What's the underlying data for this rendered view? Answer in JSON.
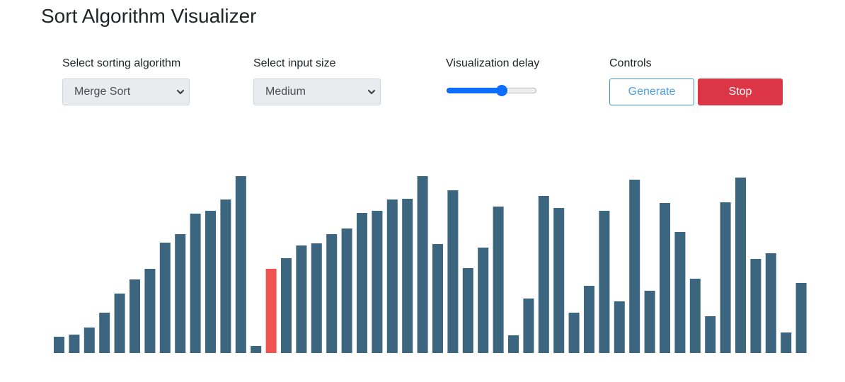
{
  "title": "Sort Algorithm Visualizer",
  "controls": {
    "algorithm": {
      "label": "Select sorting algorithm",
      "selected": "Merge Sort"
    },
    "input_size": {
      "label": "Select input size",
      "selected": "Medium"
    },
    "delay": {
      "label": "Visualization delay",
      "level_fraction": 0.63
    },
    "buttons": {
      "label": "Controls",
      "generate": "Generate",
      "stop": "Stop"
    }
  },
  "colors": {
    "bar": "#3c6580",
    "active_bar": "#f05252",
    "accent": "#0d6efd",
    "stop": "#dc3545"
  },
  "array": {
    "values": [
      23,
      26,
      36,
      57,
      84,
      104,
      119,
      156,
      168,
      197,
      201,
      217,
      250,
      10,
      119,
      134,
      152,
      155,
      168,
      176,
      198,
      201,
      217,
      218,
      250,
      154,
      230,
      120,
      149,
      207,
      25,
      77,
      222,
      205,
      57,
      95,
      201,
      73,
      245,
      88,
      212,
      171,
      105,
      52,
      213,
      248,
      133,
      141,
      29,
      99
    ],
    "active_index": 14
  }
}
